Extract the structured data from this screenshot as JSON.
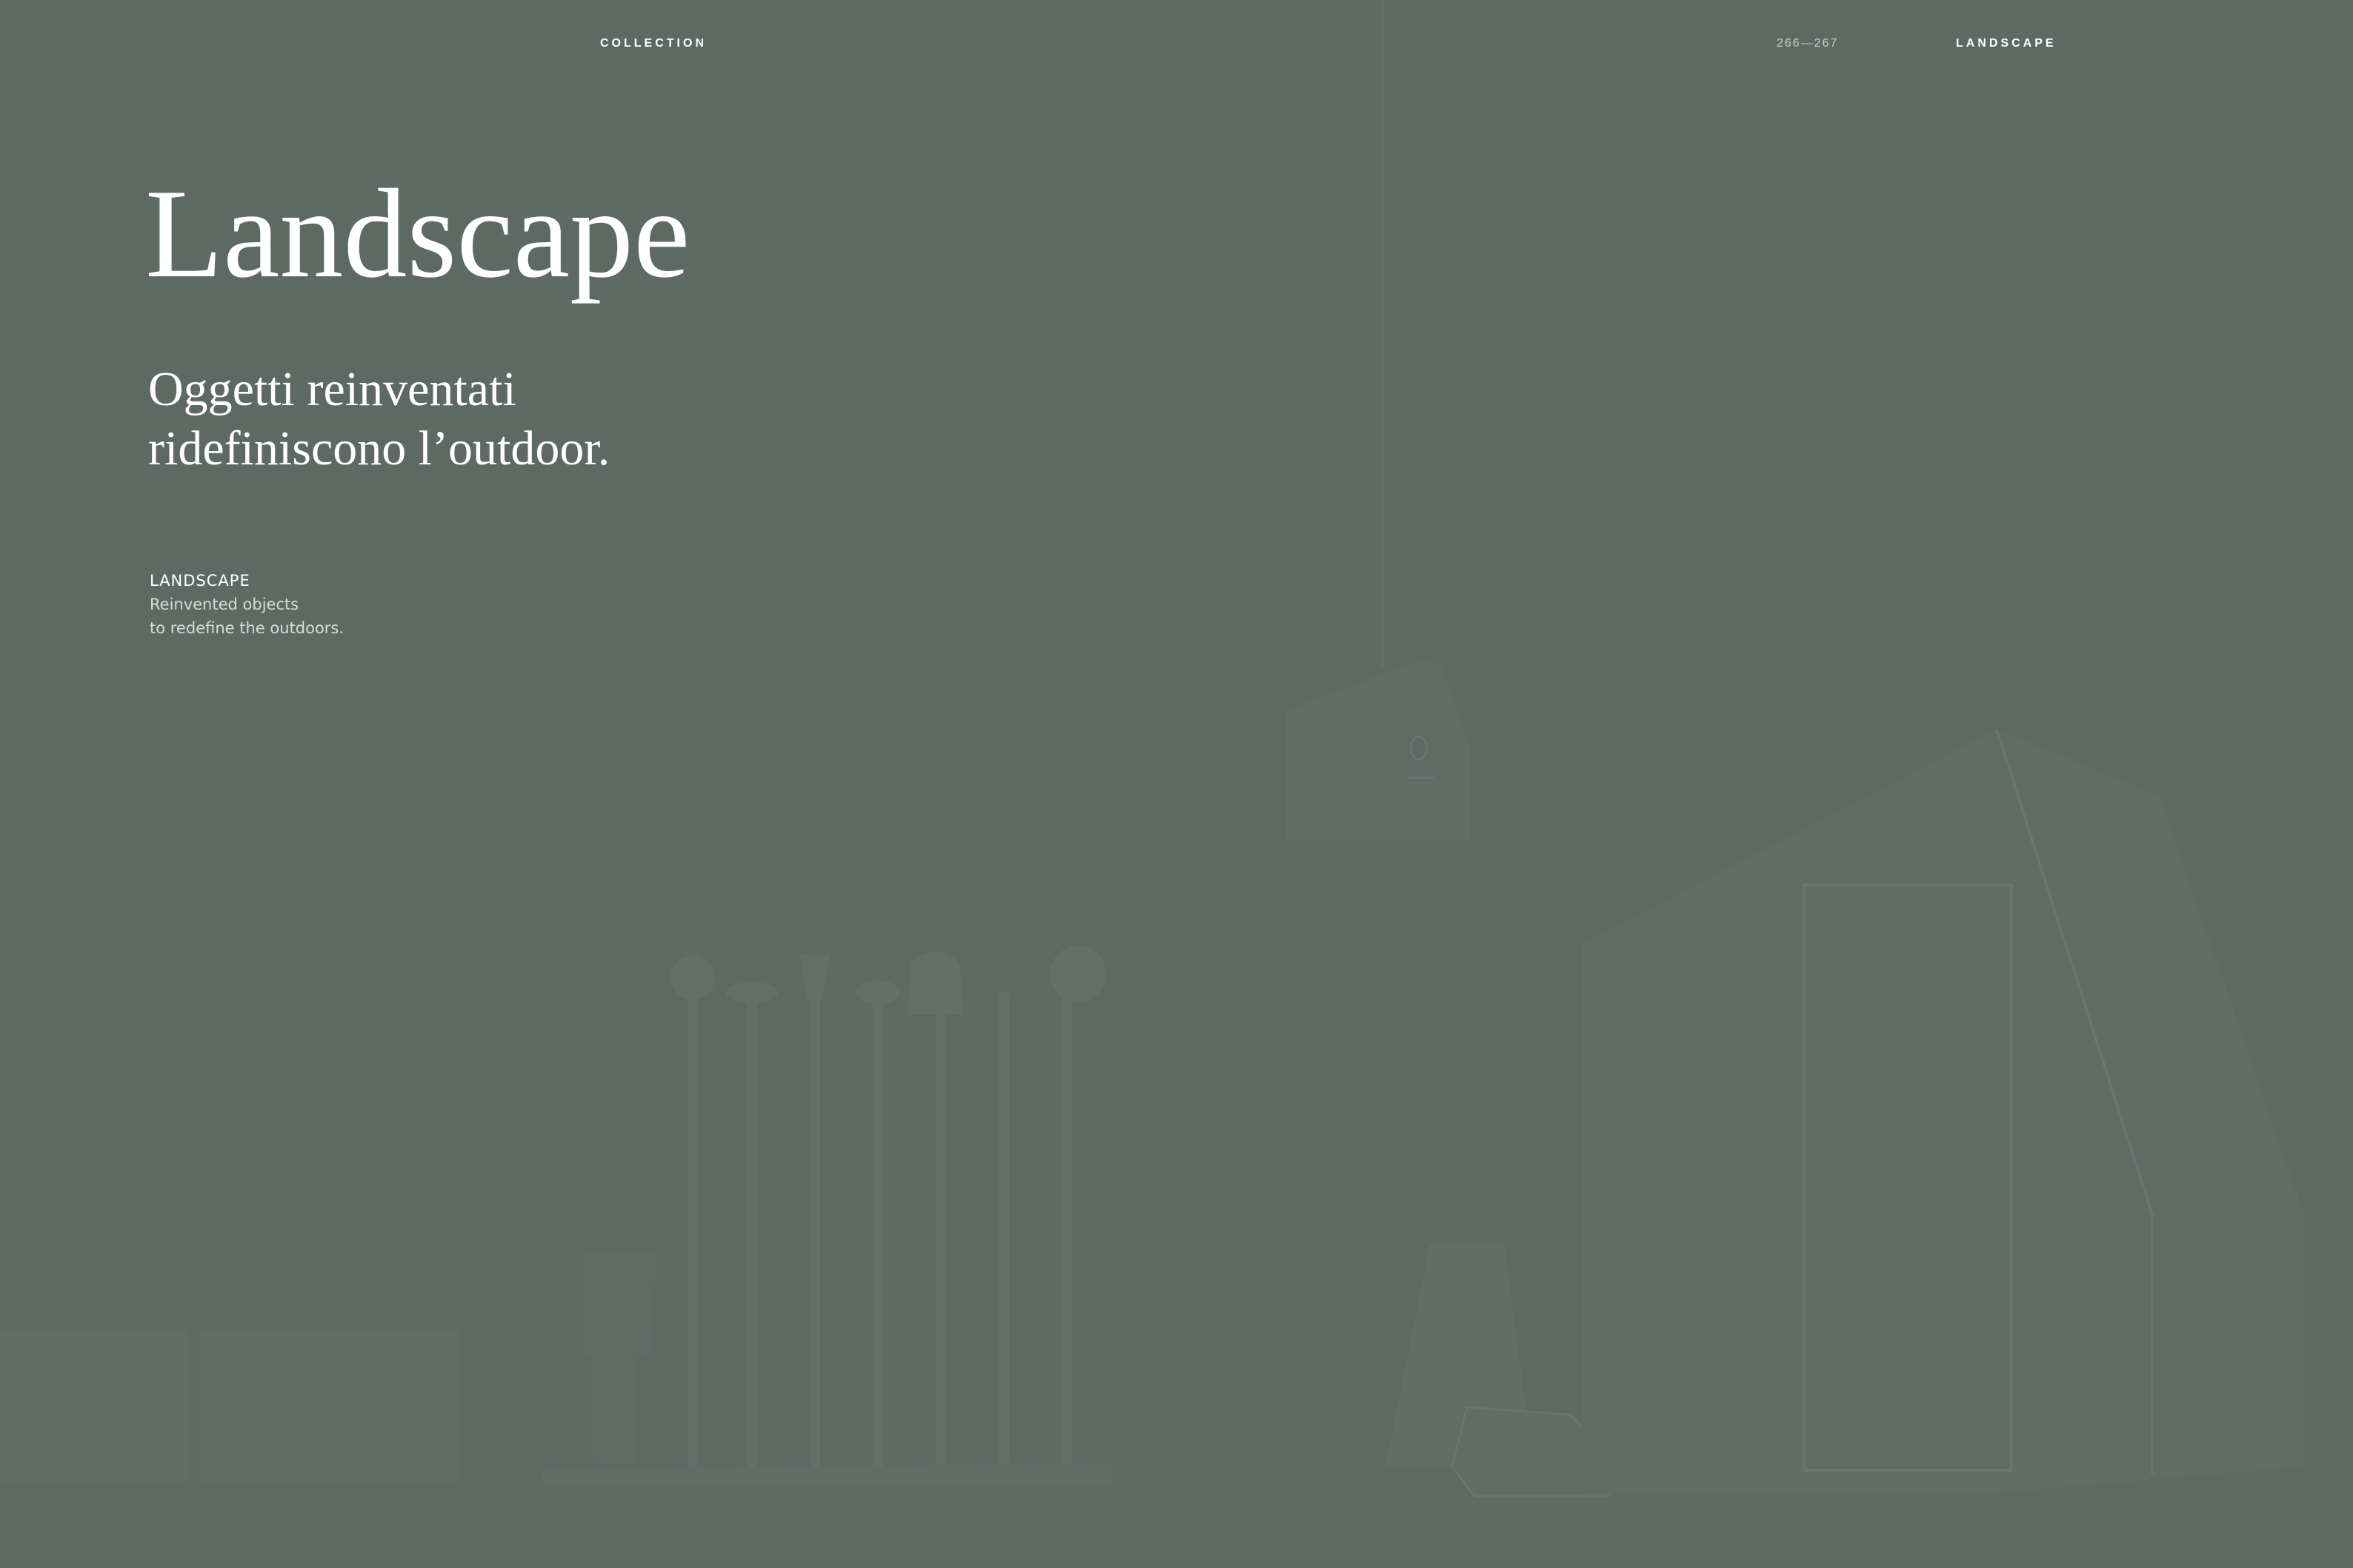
{
  "header": {
    "section_left": "COLLECTION",
    "pages": "266—267",
    "section_right": "LANDSCAPE"
  },
  "main": {
    "title": "Landscape",
    "subtitle_lines": [
      "Oggetti reinventati",
      "ridefiniscono l’outdoor."
    ],
    "caption": {
      "heading": "LANDSCAPE",
      "lines": [
        "Reinvented objects",
        "to redefine the outdoors."
      ]
    }
  },
  "colors": {
    "background": "#5d6a64",
    "text": "#ffffff"
  },
  "icons": [
    "birdhouse-illustration",
    "garden-tools-illustration",
    "shed-illustration",
    "lamp-illustration",
    "bench-illustration"
  ]
}
